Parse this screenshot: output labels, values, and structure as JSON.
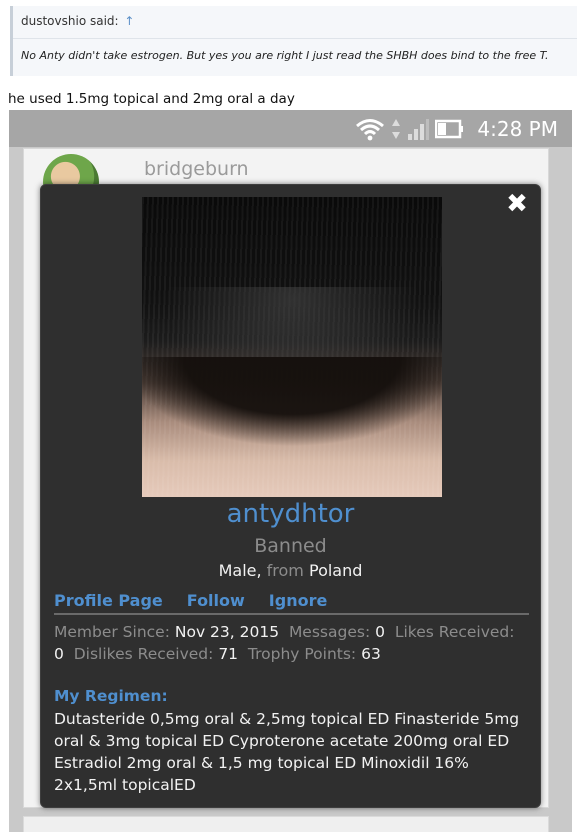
{
  "quote": {
    "author": "dustovshio said:",
    "arrow": "↑",
    "text": "No Anty didn't take estrogen. But yes you are right I just read the SHBH does bind to the free T."
  },
  "post": {
    "line": "he used 1.5mg topical and 2mg oral a day"
  },
  "statusbar": {
    "time": "4:28 PM"
  },
  "background": {
    "username": "bridgeburn"
  },
  "profile": {
    "username": "antydhtor",
    "status": "Banned",
    "gender": "Male,",
    "from_label": "from",
    "location": "Poland",
    "links": [
      "Profile Page",
      "Follow",
      "Ignore"
    ],
    "stats": {
      "member_since_label": "Member Since:",
      "member_since": "Nov 23, 2015",
      "messages_label": "Messages:",
      "messages": "0",
      "likes_label": "Likes Received:",
      "likes": "0",
      "dislikes_label": "Dislikes Received:",
      "dislikes": "71",
      "trophy_label": "Trophy Points:",
      "trophy": "63"
    },
    "regimen_title": "My Regimen:",
    "regimen_text": "Dutasteride 0,5mg oral & 2,5mg topical ED Finasteride 5mg oral & 3mg topical ED Cyproterone acetate 200mg oral ED Estradiol 2mg oral & 1,5 mg topical ED Minoxidil 16% 2x1,5ml topicalED"
  },
  "colors": {
    "link_blue": "#4f8fcf",
    "modal_bg": "#2f2f2f",
    "muted": "#8c8c8c"
  },
  "icons": [
    "wifi-icon",
    "data-arrows-icon",
    "signal-icon",
    "battery-icon",
    "close-icon"
  ]
}
